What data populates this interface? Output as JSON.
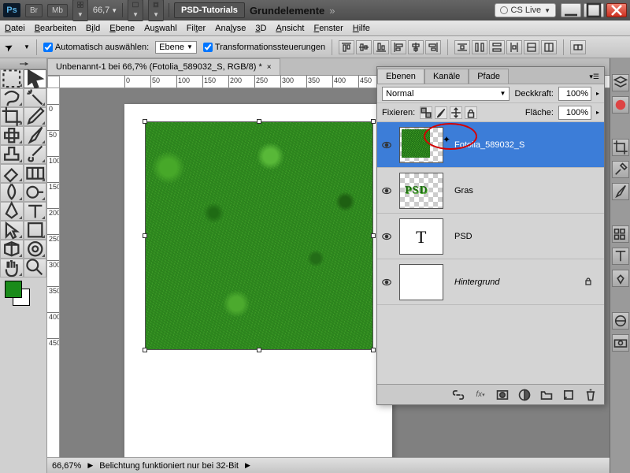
{
  "topbar": {
    "app": "Ps",
    "chips": [
      "Br",
      "Mb"
    ],
    "zoom": "66,7",
    "tutorials_btn": "PSD-Tutorials",
    "workspace_name": "Grundelemente",
    "cslive": "CS Live"
  },
  "menu": {
    "items": [
      "Datei",
      "Bearbeiten",
      "Bild",
      "Ebene",
      "Auswahl",
      "Filter",
      "Analyse",
      "3D",
      "Ansicht",
      "Fenster",
      "Hilfe"
    ],
    "underline_idx": [
      0,
      0,
      1,
      0,
      2,
      3,
      3,
      2,
      1,
      3,
      0
    ]
  },
  "optbar": {
    "auto_select_label": "Automatisch auswählen:",
    "auto_select_dd": "Ebene",
    "transform_label": "Transformationssteuerungen"
  },
  "doctab": {
    "title": "Unbenannt-1 bei 66,7% (Fotolia_589032_S, RGB/8) *"
  },
  "rulers": {
    "h_labels": [
      0,
      50,
      100,
      150,
      200,
      250,
      300,
      350,
      400,
      450
    ],
    "v_labels": [
      0,
      50,
      100,
      150,
      200,
      250,
      300,
      350,
      400,
      450
    ]
  },
  "status": {
    "zoom": "66,67%",
    "msg": "Belichtung funktioniert nur bei 32-Bit"
  },
  "layers_panel": {
    "tabs": [
      "Ebenen",
      "Kanäle",
      "Pfade"
    ],
    "blend_mode": "Normal",
    "opacity_label": "Deckkraft:",
    "opacity": "100%",
    "lock_label": "Fixieren:",
    "fill_label": "Fläche:",
    "fill": "100%",
    "layers": [
      {
        "name": "Fotolia_589032_S",
        "visible": true,
        "selected": true,
        "thumb": "grass"
      },
      {
        "name": "Gras",
        "visible": true,
        "selected": false,
        "thumb": "psd"
      },
      {
        "name": "PSD",
        "visible": true,
        "selected": false,
        "thumb": "t"
      },
      {
        "name": "Hintergrund",
        "visible": true,
        "selected": false,
        "thumb": "white",
        "italic": true,
        "locked": true
      }
    ]
  }
}
